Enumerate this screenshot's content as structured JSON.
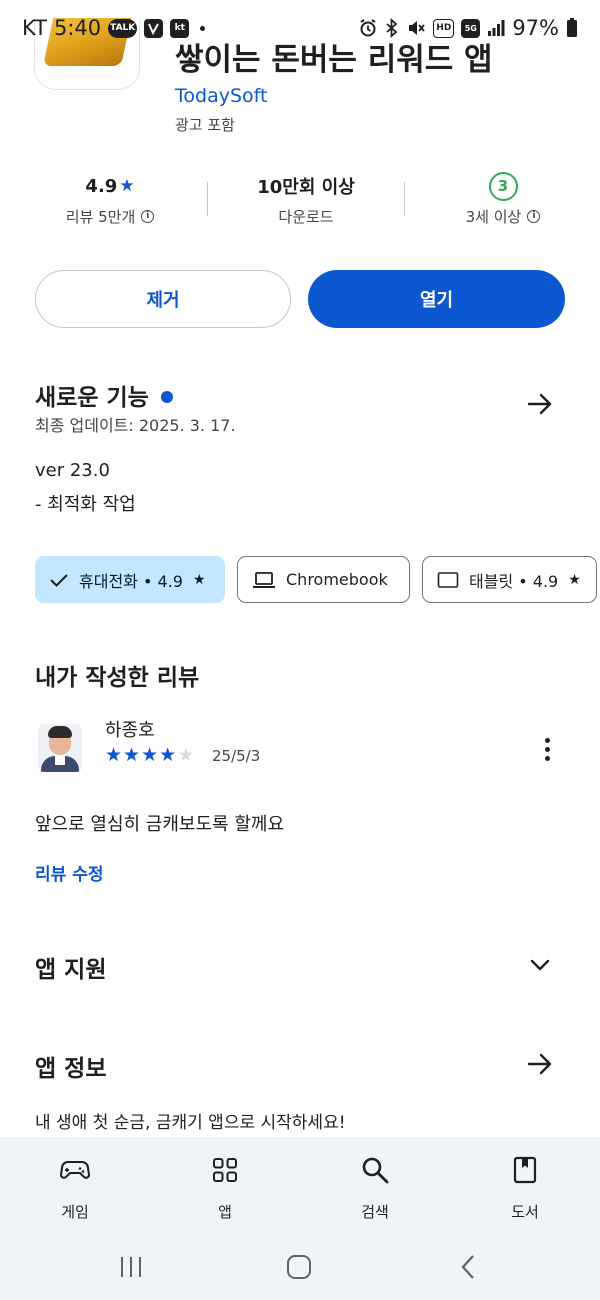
{
  "status_bar": {
    "carrier": "KT",
    "time": "5:40",
    "badges": [
      "TALK",
      "kt"
    ],
    "battery": "97%",
    "icons": [
      "alarm-icon",
      "bluetooth-icon",
      "mute-icon",
      "hd-icon",
      "5g-icon",
      "signal-icon",
      "battery-icon"
    ]
  },
  "app": {
    "title": "쌓이는 돈버는 리워드 앱",
    "developer": "TodaySoft",
    "ads_note": "광고 포함"
  },
  "stats": {
    "rating_value": "4.9",
    "rating_label": "리뷰 5만개",
    "downloads_value": "10만회 이상",
    "downloads_label": "다운로드",
    "age_value": "3",
    "age_label": "3세 이상"
  },
  "actions": {
    "uninstall_label": "제거",
    "open_label": "열기"
  },
  "whats_new": {
    "title": "새로운 기능",
    "updated": "최종 업데이트: 2025. 3. 17.",
    "version": "ver 23.0",
    "note": "- 최적화 작업"
  },
  "device_chips": [
    {
      "label": "휴대전화 • 4.9",
      "selected": true
    },
    {
      "label": "Chromebook",
      "selected": false
    },
    {
      "label": "태블릿 • 4.9",
      "selected": false
    }
  ],
  "my_review": {
    "title": "내가 작성한 리뷰",
    "reviewer": "하종호",
    "rating": 4,
    "max_rating": 5,
    "date": "25/5/3",
    "text": "앞으로 열심히 금캐보도록 할께요",
    "edit_label": "리뷰 수정"
  },
  "app_support": {
    "title": "앱 지원"
  },
  "app_info": {
    "title": "앱 정보",
    "text": "내 생애 첫 순금, 금캐기 앱으로 시작하세요!"
  },
  "bottom_nav": [
    {
      "label": "게임",
      "icon": "gamepad-icon"
    },
    {
      "label": "앱",
      "icon": "apps-grid-icon"
    },
    {
      "label": "검색",
      "icon": "search-icon"
    },
    {
      "label": "도서",
      "icon": "book-icon"
    }
  ],
  "colors": {
    "accent": "#0b57d0",
    "chip_selected_bg": "#c2e7ff",
    "age_green": "#34a853",
    "nav_bg": "#f0f4f9"
  }
}
